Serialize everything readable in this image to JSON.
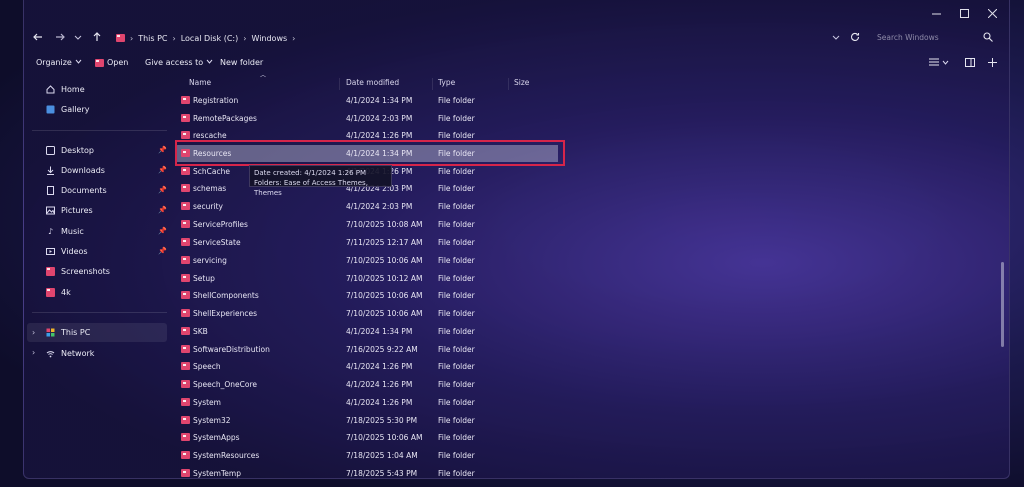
{
  "window": {
    "controls": {
      "minimize": "minimize-icon",
      "maximize": "maximize-icon",
      "close": "close-icon"
    }
  },
  "address": {
    "crumbs": [
      "This PC",
      "Local Disk (C:)",
      "Windows"
    ],
    "search_placeholder": "Search Windows"
  },
  "toolbar": {
    "organize": "Organize",
    "open": "Open",
    "give_access": "Give access to",
    "new_folder": "New folder"
  },
  "nav": {
    "top": [
      {
        "label": "Home",
        "icon": "home-icon"
      },
      {
        "label": "Gallery",
        "icon": "gallery-icon"
      }
    ],
    "quick": [
      {
        "label": "Desktop",
        "icon": "desktop-icon",
        "pinned": true
      },
      {
        "label": "Downloads",
        "icon": "download-icon",
        "pinned": true
      },
      {
        "label": "Documents",
        "icon": "document-icon",
        "pinned": true
      },
      {
        "label": "Pictures",
        "icon": "pictures-icon",
        "pinned": true
      },
      {
        "label": "Music",
        "icon": "music-icon",
        "pinned": true
      },
      {
        "label": "Videos",
        "icon": "videos-icon",
        "pinned": true
      },
      {
        "label": "Screenshots",
        "icon": "folder-icon",
        "pinned": false
      },
      {
        "label": "4k",
        "icon": "folder-icon",
        "pinned": false
      }
    ],
    "bottom": [
      {
        "label": "This PC",
        "icon": "pc-icon"
      },
      {
        "label": "Network",
        "icon": "network-icon"
      }
    ]
  },
  "columns": {
    "name": "Name",
    "date": "Date modified",
    "type": "Type",
    "size": "Size"
  },
  "rows": [
    {
      "name": "Registration",
      "date": "4/1/2024 1:34 PM",
      "type": "File folder"
    },
    {
      "name": "RemotePackages",
      "date": "4/1/2024 2:03 PM",
      "type": "File folder"
    },
    {
      "name": "rescache",
      "date": "4/1/2024 1:26 PM",
      "type": "File folder"
    },
    {
      "name": "Resources",
      "date": "4/1/2024 1:34 PM",
      "type": "File folder"
    },
    {
      "name": "SchCache",
      "date": "4/1/2024 1:26 PM",
      "type": "File folder"
    },
    {
      "name": "schemas",
      "date": "4/1/2024 2:03 PM",
      "type": "File folder"
    },
    {
      "name": "security",
      "date": "4/1/2024 2:03 PM",
      "type": "File folder"
    },
    {
      "name": "ServiceProfiles",
      "date": "7/10/2025 10:08 AM",
      "type": "File folder"
    },
    {
      "name": "ServiceState",
      "date": "7/11/2025 12:17 AM",
      "type": "File folder"
    },
    {
      "name": "servicing",
      "date": "7/10/2025 10:06 AM",
      "type": "File folder"
    },
    {
      "name": "Setup",
      "date": "7/10/2025 10:12 AM",
      "type": "File folder"
    },
    {
      "name": "ShellComponents",
      "date": "7/10/2025 10:06 AM",
      "type": "File folder"
    },
    {
      "name": "ShellExperiences",
      "date": "7/10/2025 10:06 AM",
      "type": "File folder"
    },
    {
      "name": "SKB",
      "date": "4/1/2024 1:34 PM",
      "type": "File folder"
    },
    {
      "name": "SoftwareDistribution",
      "date": "7/16/2025 9:22 AM",
      "type": "File folder"
    },
    {
      "name": "Speech",
      "date": "4/1/2024 1:26 PM",
      "type": "File folder"
    },
    {
      "name": "Speech_OneCore",
      "date": "4/1/2024 1:26 PM",
      "type": "File folder"
    },
    {
      "name": "System",
      "date": "4/1/2024 1:26 PM",
      "type": "File folder"
    },
    {
      "name": "System32",
      "date": "7/18/2025 5:30 PM",
      "type": "File folder"
    },
    {
      "name": "SystemApps",
      "date": "7/10/2025 10:06 AM",
      "type": "File folder"
    },
    {
      "name": "SystemResources",
      "date": "7/18/2025 1:04 AM",
      "type": "File folder"
    },
    {
      "name": "SystemTemp",
      "date": "7/18/2025 5:43 PM",
      "type": "File folder"
    }
  ],
  "selected_row": 3,
  "tooltip": {
    "line1": "Date created: 4/1/2024 1:26 PM",
    "line2": "Folders: Ease of Access Themes, Themes"
  },
  "colors": {
    "accent_folder": "#e0456e",
    "highlight": "#d6254a"
  }
}
